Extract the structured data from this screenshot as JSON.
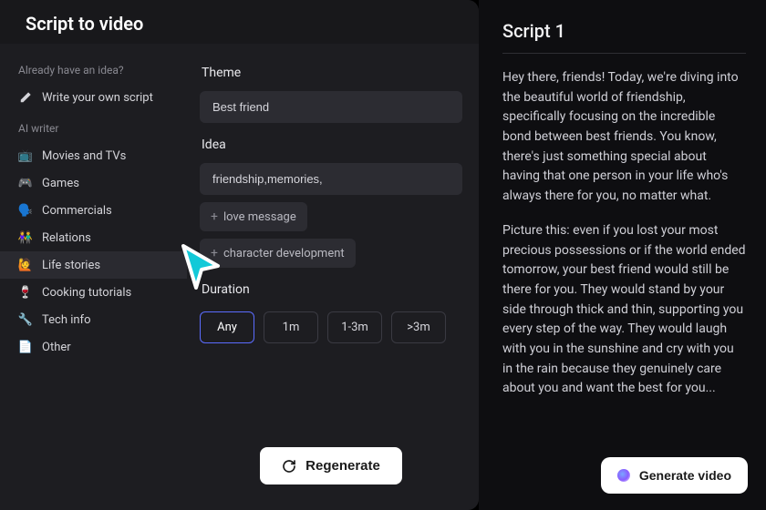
{
  "header": {
    "title": "Script to video"
  },
  "sidebar": {
    "heading1": "Already have an idea?",
    "write_label": "Write your own script",
    "heading2": "AI writer",
    "items": [
      {
        "icon": "📺",
        "label": "Movies and TVs"
      },
      {
        "icon": "🎮",
        "label": "Games"
      },
      {
        "icon": "🗣️",
        "label": "Commercials"
      },
      {
        "icon": "👫",
        "label": "Relations"
      },
      {
        "icon": "🙋",
        "label": "Life stories"
      },
      {
        "icon": "🍷",
        "label": "Cooking tutorials"
      },
      {
        "icon": "🔧",
        "label": "Tech info"
      },
      {
        "icon": "📄",
        "label": "Other"
      }
    ],
    "active_index": 4
  },
  "form": {
    "theme_label": "Theme",
    "theme_value": "Best friend",
    "idea_label": "Idea",
    "idea_value": "friendship,memories,",
    "chips": [
      "love message",
      "character development"
    ],
    "duration_label": "Duration",
    "durations": [
      "Any",
      "1m",
      "1-3m",
      ">3m"
    ],
    "duration_selected": 0,
    "regenerate_label": "Regenerate"
  },
  "script": {
    "title": "Script 1",
    "p1": "Hey there, friends! Today, we're diving into the beautiful world of friendship, specifically focusing on the incredible bond between best friends. You know, there's just something special about having that one person in your life who's always there for you, no matter what.",
    "p2": "Picture this: even if you lost your most precious possessions or if the world ended tomorrow, your best friend would still be there for you. They would stand by your side through thick and thin, supporting you every step of the way. They would laugh with you in the sunshine and cry with you in the rain because they genuinely care about you and want the best for you...",
    "generate_label": "Generate video"
  }
}
